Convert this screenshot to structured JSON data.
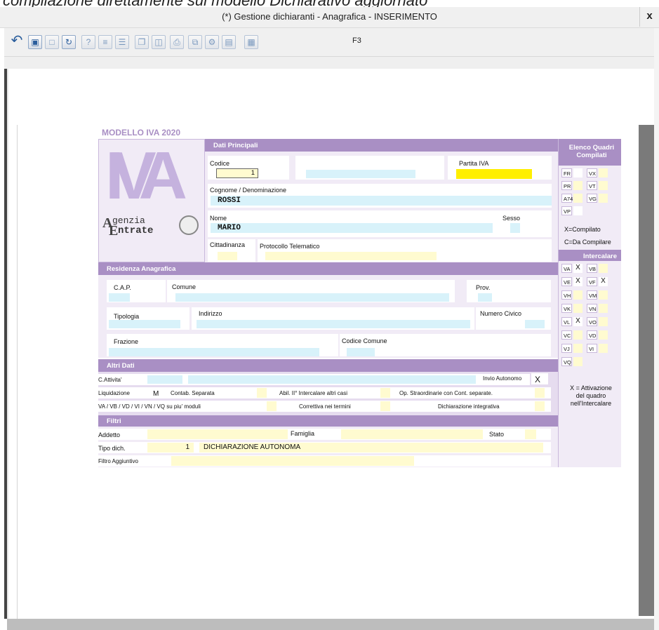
{
  "caption": "compilazione direttamente sul modello Dichiarativo aggiornato",
  "window": {
    "title": "(*) Gestione dichiaranti - Anagrafica - INSERIMENTO",
    "close": "x"
  },
  "toolbar": {
    "shortcut": "F3"
  },
  "form": {
    "model_title": "MODELLO IVA 2020",
    "logo": {
      "big": "IVA",
      "agenzia": "genzia",
      "entrate": "ntrate",
      "a": "A",
      "e": "E"
    },
    "dati_principali": {
      "header": "Dati Principali",
      "codice_label": "Codice",
      "codice_value": "1",
      "partita_iva_label": "Partita IVA",
      "cognome_label": "Cognome / Denominazione",
      "cognome_value": "ROSSI",
      "nome_label": "Nome",
      "nome_value": "MARIO",
      "sesso_label": "Sesso",
      "cittadinanza_label": "Cittadinanza",
      "protocollo_label": "Protocollo Telematico"
    },
    "residenza": {
      "header": "Residenza Anagrafica",
      "cap_label": "C.A.P.",
      "comune_label": "Comune",
      "prov_label": "Prov.",
      "tipologia_label": "Tipologia",
      "indirizzo_label": "Indirizzo",
      "numero_civico_label": "Numero Civico",
      "frazione_label": "Frazione",
      "codice_comune_label": "Codice Comune"
    },
    "altri_dati": {
      "header": "Altri Dati",
      "attivita_label": "C.Attivita'",
      "invio_autonomo_label": "Invio Autonomo",
      "invio_autonomo_value": "X",
      "liquidazione_label": "Liquidazione",
      "liquidazione_value": "M",
      "contab_label": "Contab. Separata",
      "abil_label": "Abil. II° Intercalare altri casi",
      "op_straord_label": "Op. Straordinarie con Cont. separate.",
      "va_label": "VA / VB / VD / VI / VN / VQ su piu' moduli",
      "correttiva_label": "Correttiva nei termini",
      "integrativa_label": "Dichiarazione integrativa"
    },
    "filtri": {
      "header": "Filtri",
      "addetto_label": "Addetto",
      "famiglia_label": "Famiglia",
      "stato_label": "Stato",
      "tipo_label": "Tipo dich.",
      "tipo_code": "1",
      "tipo_desc": "DICHIARAZIONE AUTONOMA",
      "filtro_label": "Filtro Aggiuntivo"
    },
    "elenco": {
      "header": "Elenco Quadri Compilati",
      "rows": [
        [
          "FR",
          "VX"
        ],
        [
          "PR",
          "VT"
        ],
        [
          "A74",
          "VG"
        ],
        [
          "VP",
          ""
        ]
      ],
      "legend1": "X=Compilato",
      "legend2": "C=Da Compilare"
    },
    "intercalare": {
      "header": "Intercalare",
      "rows": [
        {
          "a": "VA",
          "av": "X",
          "b": "VB",
          "bv": ""
        },
        {
          "a": "VE",
          "av": "X",
          "b": "VF",
          "bv": "X"
        },
        {
          "a": "VH",
          "av": "",
          "b": "VM",
          "bv": ""
        },
        {
          "a": "VK",
          "av": "",
          "b": "VN",
          "bv": ""
        },
        {
          "a": "VL",
          "av": "X",
          "b": "VO",
          "bv": ""
        },
        {
          "a": "VC",
          "av": "",
          "b": "VD",
          "bv": ""
        },
        {
          "a": "VJ",
          "av": "",
          "b": "VI",
          "bv": ""
        },
        {
          "a": "VQ",
          "av": "",
          "b": "",
          "bv": ""
        }
      ],
      "legend1": "X = Attivazione",
      "legend2": "del quadro",
      "legend3": "nell'Intercalare"
    }
  }
}
